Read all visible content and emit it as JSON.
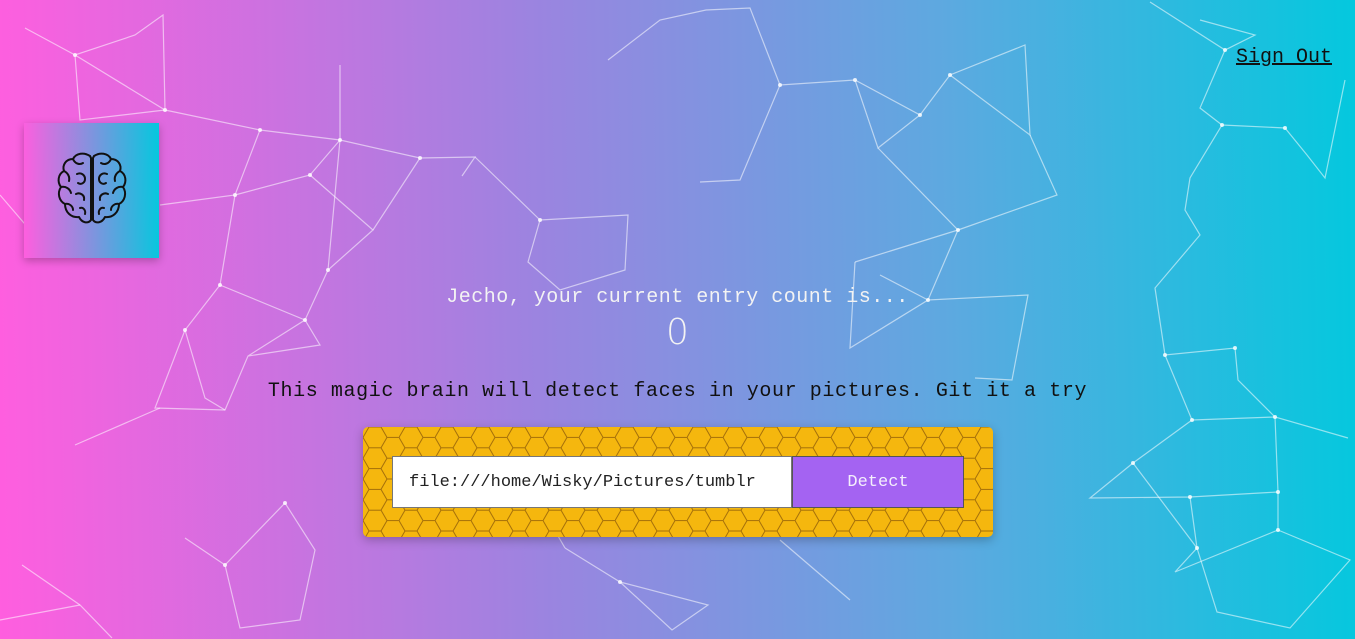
{
  "nav": {
    "signout_label": "Sign Out"
  },
  "logo": {
    "icon": "brain-icon"
  },
  "rank": {
    "message": "Jecho, your current entry count is...",
    "count": "0"
  },
  "image_link_form": {
    "intro_text": "This magic brain will detect faces in your pictures. Git it a try",
    "url_value": "file:///home/Wisky/Pictures/tumblr",
    "detect_label": "Detect"
  },
  "colors": {
    "gradient_left": "#ff5edf",
    "gradient_right": "#04c8de",
    "form_background": "#f5b70e",
    "detect_button": "#a463f2"
  }
}
